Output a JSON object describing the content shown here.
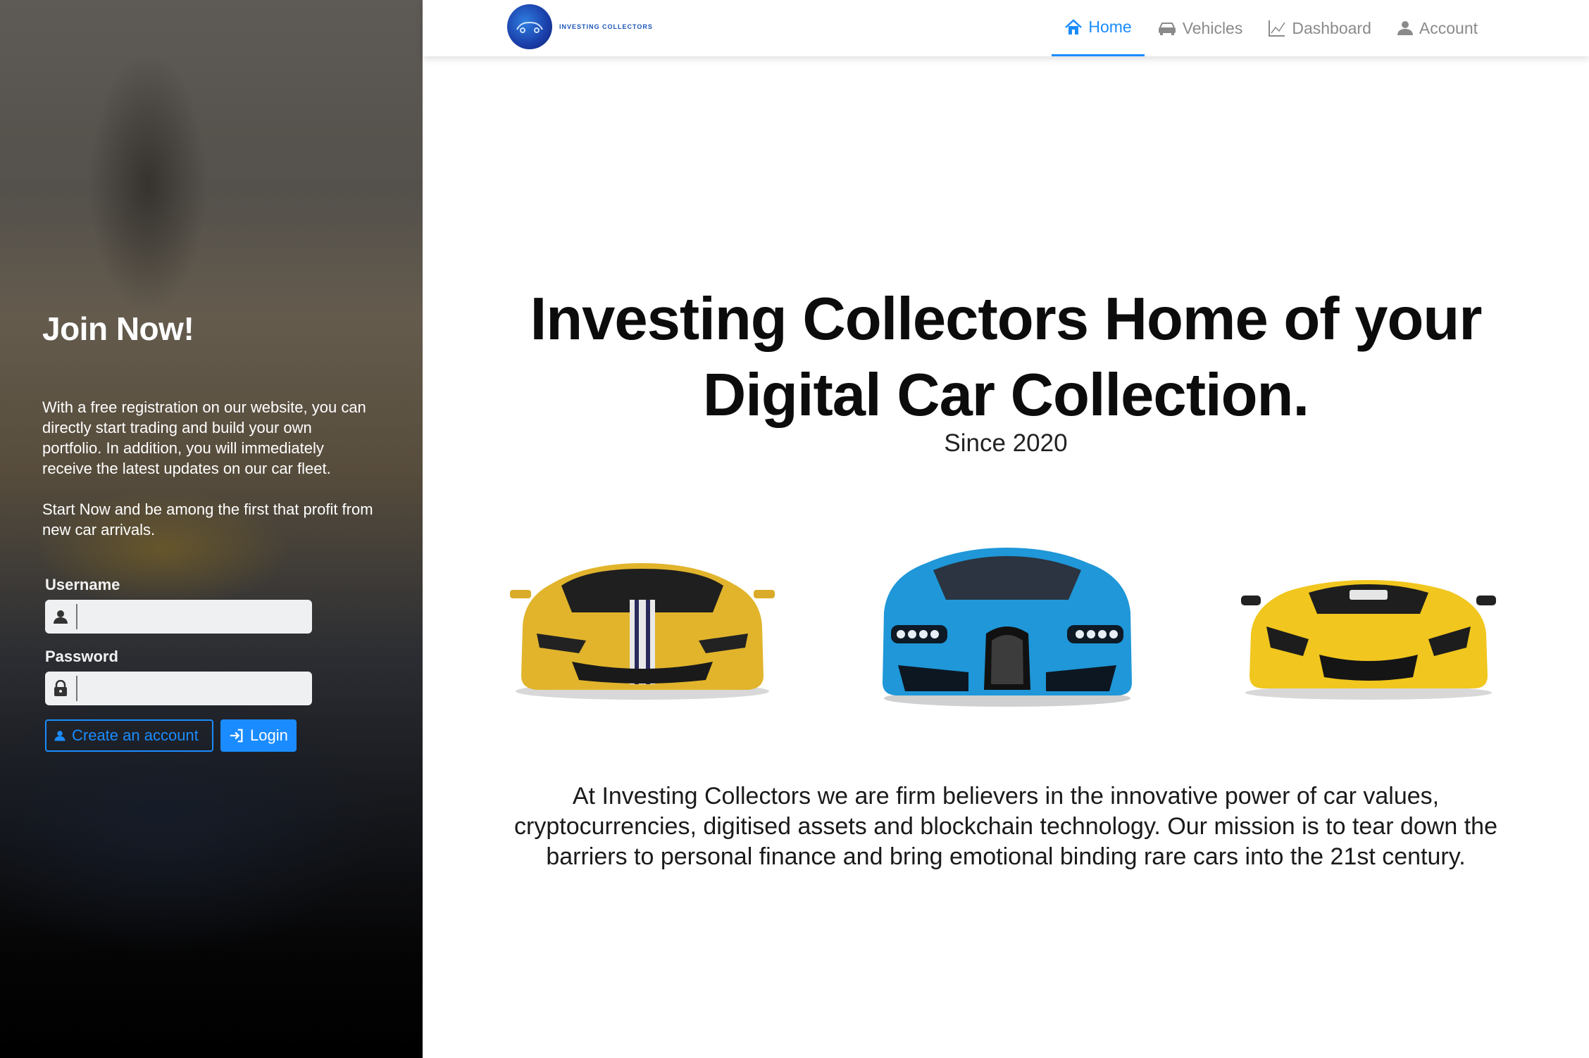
{
  "sidebar": {
    "title": "Join Now!",
    "paragraphs": [
      "With a free registration on our website, you can directly start trading and build your own portfolio. In addition, you will immediately receive the latest updates on our car fleet.",
      "Start Now and be among the first that profit from new car arrivals."
    ],
    "username_label": "Username",
    "username_value": "",
    "password_label": "Password",
    "password_value": "",
    "create_account_label": "Create an account",
    "login_label": "Login"
  },
  "navbar": {
    "logo_text": "INVESTING COLLECTORS",
    "items": [
      {
        "label": "Home",
        "icon": "home-icon",
        "active": true
      },
      {
        "label": "Vehicles",
        "icon": "car-icon",
        "active": false
      },
      {
        "label": "Dashboard",
        "icon": "chart-icon",
        "active": false
      },
      {
        "label": "Account",
        "icon": "user-icon",
        "active": false
      }
    ]
  },
  "main": {
    "headline_line1": "Investing Collectors Home of your",
    "headline_line2": "Digital Car Collection.",
    "since": "Since 2020",
    "cars": [
      "yellow-sports-car-image",
      "blue-hypercar-image",
      "yellow-coupe-image"
    ],
    "mission": "At Investing Collectors we are firm believers in the innovative power of car values, cryptocurrencies, digitised assets and blockchain technology. Our mission is to tear down the barriers to personal finance and bring emotional binding rare cars into the 21st century."
  },
  "colors": {
    "accent": "#1a8cff",
    "nav_inactive": "#8a8a8a"
  }
}
